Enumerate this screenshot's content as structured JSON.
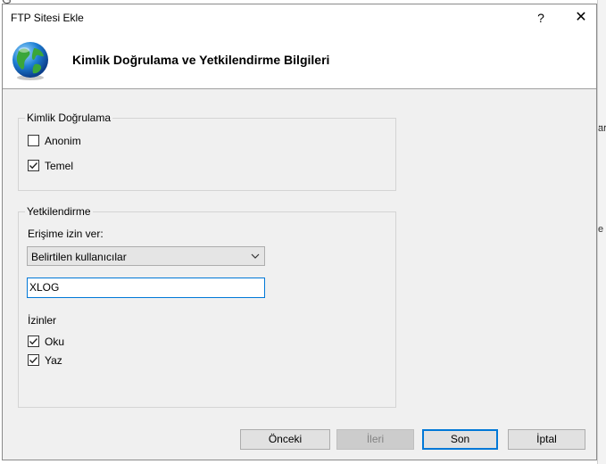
{
  "background": {
    "title_fragment": "G ",
    "right_fragments": [
      "...",
      "ar",
      "e"
    ]
  },
  "dialog": {
    "title": "FTP Sitesi Ekle",
    "help_label": "?",
    "close_label": "✕",
    "header_title": "Kimlik Doğrulama ve Yetkilendirme Bilgileri",
    "header_icon": "globe-icon"
  },
  "authentication": {
    "group_label": "Kimlik Doğrulama",
    "anonymous": {
      "label": "Anonim",
      "checked": false
    },
    "basic": {
      "label": "Temel",
      "checked": true
    }
  },
  "authorization": {
    "group_label": "Yetkilendirme",
    "access_label": "Erişime izin ver:",
    "access_selected": "Belirtilen kullanıcılar",
    "users_value": "XLOG",
    "permissions_label": "İzinler",
    "read": {
      "label": "Oku",
      "checked": true
    },
    "write": {
      "label": "Yaz",
      "checked": true
    }
  },
  "buttons": {
    "previous": "Önceki",
    "next": "İleri",
    "finish": "Son",
    "cancel": "İptal"
  },
  "colors": {
    "dialog_bg": "#f0f0f0",
    "accent": "#0078d7",
    "disabled_text": "#838383"
  }
}
